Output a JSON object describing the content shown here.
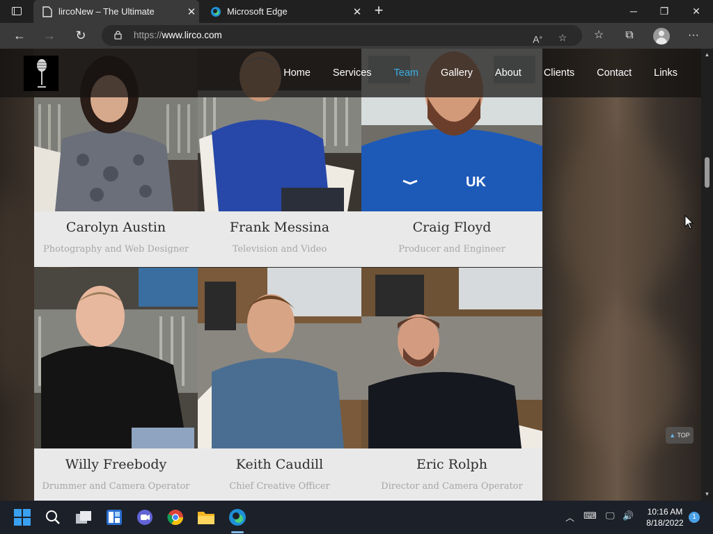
{
  "browser": {
    "tabs": [
      {
        "title": "lircoNew – The Ultimate",
        "icon": "page-icon",
        "active": true
      },
      {
        "title": "Microsoft Edge",
        "icon": "edge-icon",
        "active": false
      }
    ],
    "url_protocol": "https://",
    "url_host": "www.lirco.com"
  },
  "site": {
    "nav": [
      "Home",
      "Services",
      "Team",
      "Gallery",
      "About",
      "Clients",
      "Contact",
      "Links"
    ],
    "current_nav": "Team",
    "accent_color": "#3ab0e6",
    "top_button": "TOP"
  },
  "team": [
    {
      "name": "Carolyn Austin",
      "role": "Photography and Web Designer",
      "shirt": "#6a6f7a"
    },
    {
      "name": "Frank Messina",
      "role": "Television and Video",
      "shirt": "#2748a8"
    },
    {
      "name": "Craig Floyd",
      "role": "Producer and Engineer",
      "shirt": "#1d5ab8"
    },
    {
      "name": "Willy Freebody",
      "role": "Drummer and Camera Operator",
      "shirt": "#141414"
    },
    {
      "name": "Keith Caudill",
      "role": "Chief Creative Officer",
      "shirt": "#4a6e92"
    },
    {
      "name": "Eric Rolph",
      "role": "Director and Camera Operator",
      "shirt": "#16181f"
    }
  ],
  "taskbar": {
    "time": "10:16 AM",
    "date": "8/18/2022",
    "notifications": "1"
  }
}
